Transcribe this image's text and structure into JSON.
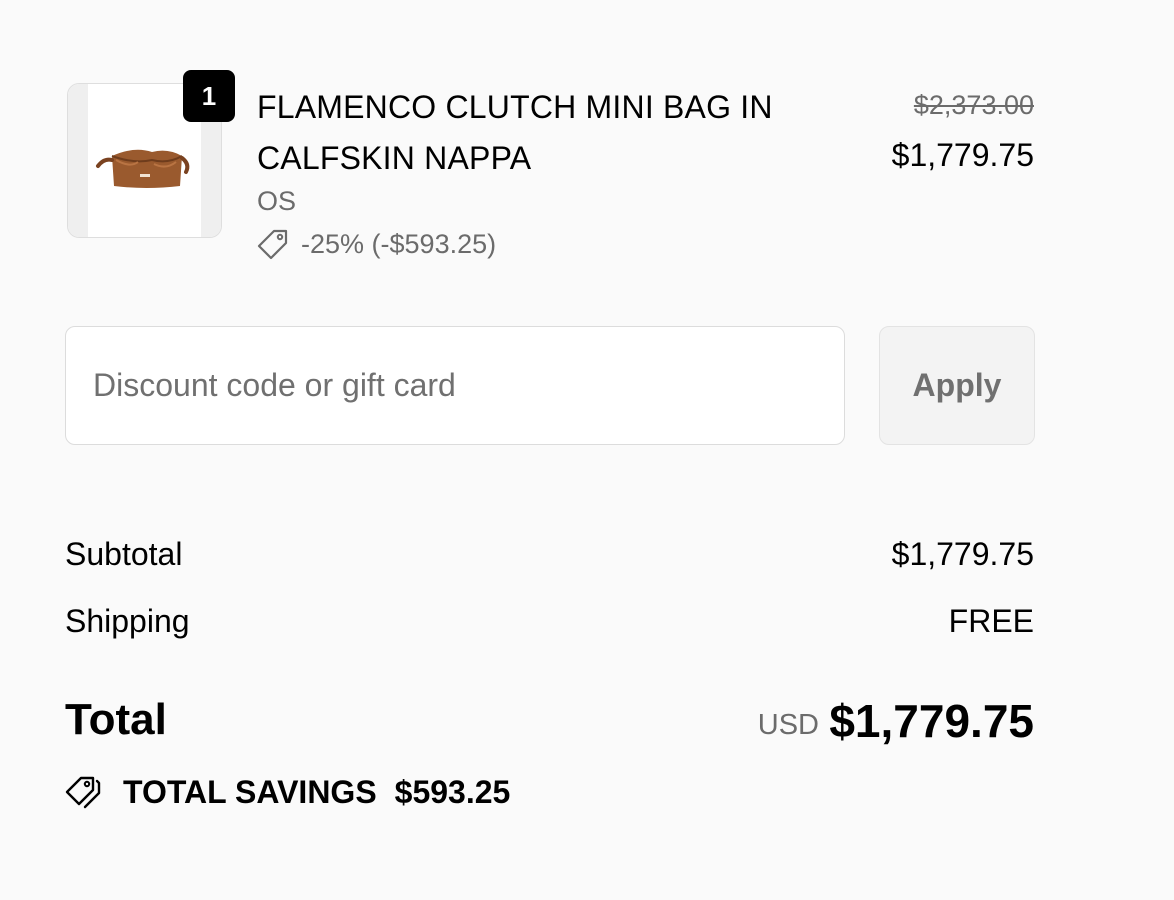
{
  "product": {
    "quantity": "1",
    "name": "FLAMENCO CLUTCH MINI BAG IN CALFSKIN NAPPA",
    "variant": "OS",
    "discount": "-25% (-$593.25)",
    "price_original": "$2,373.00",
    "price_current": "$1,779.75",
    "image_icon": "clutch-bag-icon"
  },
  "discount_form": {
    "placeholder": "Discount code or gift card",
    "value": "",
    "apply_label": "Apply"
  },
  "summary": {
    "subtotal_label": "Subtotal",
    "subtotal_value": "$1,779.75",
    "shipping_label": "Shipping",
    "shipping_value": "FREE",
    "total_label": "Total",
    "currency": "USD",
    "total_value": "$1,779.75",
    "savings_label": "TOTAL SAVINGS",
    "savings_value": "$593.25"
  },
  "colors": {
    "background": "#fafafa",
    "text": "#000000",
    "muted": "#6b6b6b",
    "bag": "#9a5a2e"
  }
}
